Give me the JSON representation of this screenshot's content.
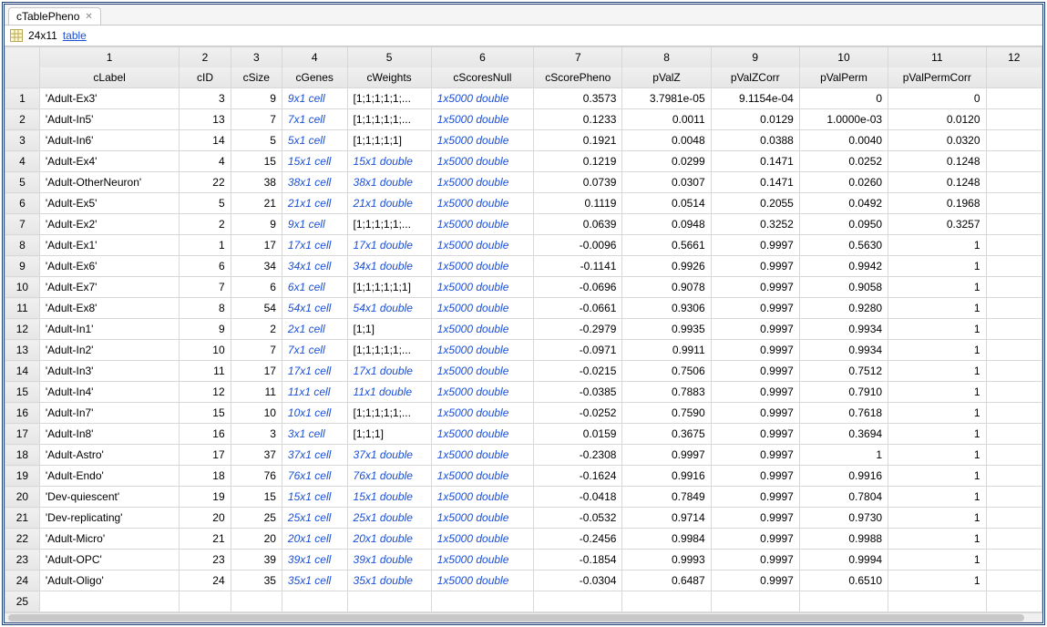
{
  "tab": {
    "title": "cTablePheno"
  },
  "summary": {
    "dims": "24x11",
    "type_link": "table"
  },
  "columns": [
    {
      "num": "1",
      "name": "cLabel",
      "align": "la"
    },
    {
      "num": "2",
      "name": "cID",
      "align": "ra"
    },
    {
      "num": "3",
      "name": "cSize",
      "align": "ra"
    },
    {
      "num": "4",
      "name": "cGenes",
      "align": "la",
      "link": true
    },
    {
      "num": "5",
      "name": "cWeights",
      "align": "la"
    },
    {
      "num": "6",
      "name": "cScoresNull",
      "align": "la",
      "link": true
    },
    {
      "num": "7",
      "name": "cScorePheno",
      "align": "ra"
    },
    {
      "num": "8",
      "name": "pValZ",
      "align": "ra"
    },
    {
      "num": "9",
      "name": "pValZCorr",
      "align": "ra"
    },
    {
      "num": "10",
      "name": "pValPerm",
      "align": "ra"
    },
    {
      "num": "11",
      "name": "pValPermCorr",
      "align": "ra"
    },
    {
      "num": "12",
      "name": "",
      "align": "la"
    }
  ],
  "rows": [
    {
      "n": "1",
      "cLabel": "'Adult-Ex3'",
      "cID": "3",
      "cSize": "9",
      "cGenes": "9x1 cell",
      "cWeights": "[1;1;1;1;1;...",
      "cScoresNull": "1x5000 double",
      "cScorePheno": "0.3573",
      "pValZ": "3.7981e-05",
      "pValZCorr": "9.1154e-04",
      "pValPerm": "0",
      "pValPermCorr": "0"
    },
    {
      "n": "2",
      "cLabel": "'Adult-In5'",
      "cID": "13",
      "cSize": "7",
      "cGenes": "7x1 cell",
      "cWeights": "[1;1;1;1;1;...",
      "cScoresNull": "1x5000 double",
      "cScorePheno": "0.1233",
      "pValZ": "0.0011",
      "pValZCorr": "0.0129",
      "pValPerm": "1.0000e-03",
      "pValPermCorr": "0.0120"
    },
    {
      "n": "3",
      "cLabel": "'Adult-In6'",
      "cID": "14",
      "cSize": "5",
      "cGenes": "5x1 cell",
      "cWeights": "[1;1;1;1;1]",
      "cScoresNull": "1x5000 double",
      "cScorePheno": "0.1921",
      "pValZ": "0.0048",
      "pValZCorr": "0.0388",
      "pValPerm": "0.0040",
      "pValPermCorr": "0.0320"
    },
    {
      "n": "4",
      "cLabel": "'Adult-Ex4'",
      "cID": "4",
      "cSize": "15",
      "cGenes": "15x1 cell",
      "cWeights": "15x1 double",
      "wlink": true,
      "cScoresNull": "1x5000 double",
      "cScorePheno": "0.1219",
      "pValZ": "0.0299",
      "pValZCorr": "0.1471",
      "pValPerm": "0.0252",
      "pValPermCorr": "0.1248"
    },
    {
      "n": "5",
      "cLabel": "'Adult-OtherNeuron'",
      "cID": "22",
      "cSize": "38",
      "cGenes": "38x1 cell",
      "cWeights": "38x1 double",
      "wlink": true,
      "cScoresNull": "1x5000 double",
      "cScorePheno": "0.0739",
      "pValZ": "0.0307",
      "pValZCorr": "0.1471",
      "pValPerm": "0.0260",
      "pValPermCorr": "0.1248"
    },
    {
      "n": "6",
      "cLabel": "'Adult-Ex5'",
      "cID": "5",
      "cSize": "21",
      "cGenes": "21x1 cell",
      "cWeights": "21x1 double",
      "wlink": true,
      "cScoresNull": "1x5000 double",
      "cScorePheno": "0.1119",
      "pValZ": "0.0514",
      "pValZCorr": "0.2055",
      "pValPerm": "0.0492",
      "pValPermCorr": "0.1968"
    },
    {
      "n": "7",
      "cLabel": "'Adult-Ex2'",
      "cID": "2",
      "cSize": "9",
      "cGenes": "9x1 cell",
      "cWeights": "[1;1;1;1;1;...",
      "cScoresNull": "1x5000 double",
      "cScorePheno": "0.0639",
      "pValZ": "0.0948",
      "pValZCorr": "0.3252",
      "pValPerm": "0.0950",
      "pValPermCorr": "0.3257"
    },
    {
      "n": "8",
      "cLabel": "'Adult-Ex1'",
      "cID": "1",
      "cSize": "17",
      "cGenes": "17x1 cell",
      "cWeights": "17x1 double",
      "wlink": true,
      "cScoresNull": "1x5000 double",
      "cScorePheno": "-0.0096",
      "pValZ": "0.5661",
      "pValZCorr": "0.9997",
      "pValPerm": "0.5630",
      "pValPermCorr": "1"
    },
    {
      "n": "9",
      "cLabel": "'Adult-Ex6'",
      "cID": "6",
      "cSize": "34",
      "cGenes": "34x1 cell",
      "cWeights": "34x1 double",
      "wlink": true,
      "cScoresNull": "1x5000 double",
      "cScorePheno": "-0.1141",
      "pValZ": "0.9926",
      "pValZCorr": "0.9997",
      "pValPerm": "0.9942",
      "pValPermCorr": "1"
    },
    {
      "n": "10",
      "cLabel": "'Adult-Ex7'",
      "cID": "7",
      "cSize": "6",
      "cGenes": "6x1 cell",
      "cWeights": "[1;1;1;1;1;1]",
      "cScoresNull": "1x5000 double",
      "cScorePheno": "-0.0696",
      "pValZ": "0.9078",
      "pValZCorr": "0.9997",
      "pValPerm": "0.9058",
      "pValPermCorr": "1"
    },
    {
      "n": "11",
      "cLabel": "'Adult-Ex8'",
      "cID": "8",
      "cSize": "54",
      "cGenes": "54x1 cell",
      "cWeights": "54x1 double",
      "wlink": true,
      "cScoresNull": "1x5000 double",
      "cScorePheno": "-0.0661",
      "pValZ": "0.9306",
      "pValZCorr": "0.9997",
      "pValPerm": "0.9280",
      "pValPermCorr": "1"
    },
    {
      "n": "12",
      "cLabel": "'Adult-In1'",
      "cID": "9",
      "cSize": "2",
      "cGenes": "2x1 cell",
      "cWeights": "[1;1]",
      "cScoresNull": "1x5000 double",
      "cScorePheno": "-0.2979",
      "pValZ": "0.9935",
      "pValZCorr": "0.9997",
      "pValPerm": "0.9934",
      "pValPermCorr": "1"
    },
    {
      "n": "13",
      "cLabel": "'Adult-In2'",
      "cID": "10",
      "cSize": "7",
      "cGenes": "7x1 cell",
      "cWeights": "[1;1;1;1;1;...",
      "cScoresNull": "1x5000 double",
      "cScorePheno": "-0.0971",
      "pValZ": "0.9911",
      "pValZCorr": "0.9997",
      "pValPerm": "0.9934",
      "pValPermCorr": "1"
    },
    {
      "n": "14",
      "cLabel": "'Adult-In3'",
      "cID": "11",
      "cSize": "17",
      "cGenes": "17x1 cell",
      "cWeights": "17x1 double",
      "wlink": true,
      "cScoresNull": "1x5000 double",
      "cScorePheno": "-0.0215",
      "pValZ": "0.7506",
      "pValZCorr": "0.9997",
      "pValPerm": "0.7512",
      "pValPermCorr": "1"
    },
    {
      "n": "15",
      "cLabel": "'Adult-In4'",
      "cID": "12",
      "cSize": "11",
      "cGenes": "11x1 cell",
      "cWeights": "11x1 double",
      "wlink": true,
      "cScoresNull": "1x5000 double",
      "cScorePheno": "-0.0385",
      "pValZ": "0.7883",
      "pValZCorr": "0.9997",
      "pValPerm": "0.7910",
      "pValPermCorr": "1"
    },
    {
      "n": "16",
      "cLabel": "'Adult-In7'",
      "cID": "15",
      "cSize": "10",
      "cGenes": "10x1 cell",
      "cWeights": "[1;1;1;1;1;...",
      "cScoresNull": "1x5000 double",
      "cScorePheno": "-0.0252",
      "pValZ": "0.7590",
      "pValZCorr": "0.9997",
      "pValPerm": "0.7618",
      "pValPermCorr": "1"
    },
    {
      "n": "17",
      "cLabel": "'Adult-In8'",
      "cID": "16",
      "cSize": "3",
      "cGenes": "3x1 cell",
      "cWeights": "[1;1;1]",
      "cScoresNull": "1x5000 double",
      "cScorePheno": "0.0159",
      "pValZ": "0.3675",
      "pValZCorr": "0.9997",
      "pValPerm": "0.3694",
      "pValPermCorr": "1"
    },
    {
      "n": "18",
      "cLabel": "'Adult-Astro'",
      "cID": "17",
      "cSize": "37",
      "cGenes": "37x1 cell",
      "cWeights": "37x1 double",
      "wlink": true,
      "cScoresNull": "1x5000 double",
      "cScorePheno": "-0.2308",
      "pValZ": "0.9997",
      "pValZCorr": "0.9997",
      "pValPerm": "1",
      "pValPermCorr": "1"
    },
    {
      "n": "19",
      "cLabel": "'Adult-Endo'",
      "cID": "18",
      "cSize": "76",
      "cGenes": "76x1 cell",
      "cWeights": "76x1 double",
      "wlink": true,
      "cScoresNull": "1x5000 double",
      "cScorePheno": "-0.1624",
      "pValZ": "0.9916",
      "pValZCorr": "0.9997",
      "pValPerm": "0.9916",
      "pValPermCorr": "1"
    },
    {
      "n": "20",
      "cLabel": "'Dev-quiescent'",
      "cID": "19",
      "cSize": "15",
      "cGenes": "15x1 cell",
      "cWeights": "15x1 double",
      "wlink": true,
      "cScoresNull": "1x5000 double",
      "cScorePheno": "-0.0418",
      "pValZ": "0.7849",
      "pValZCorr": "0.9997",
      "pValPerm": "0.7804",
      "pValPermCorr": "1"
    },
    {
      "n": "21",
      "cLabel": "'Dev-replicating'",
      "cID": "20",
      "cSize": "25",
      "cGenes": "25x1 cell",
      "cWeights": "25x1 double",
      "wlink": true,
      "cScoresNull": "1x5000 double",
      "cScorePheno": "-0.0532",
      "pValZ": "0.9714",
      "pValZCorr": "0.9997",
      "pValPerm": "0.9730",
      "pValPermCorr": "1"
    },
    {
      "n": "22",
      "cLabel": "'Adult-Micro'",
      "cID": "21",
      "cSize": "20",
      "cGenes": "20x1 cell",
      "cWeights": "20x1 double",
      "wlink": true,
      "cScoresNull": "1x5000 double",
      "cScorePheno": "-0.2456",
      "pValZ": "0.9984",
      "pValZCorr": "0.9997",
      "pValPerm": "0.9988",
      "pValPermCorr": "1"
    },
    {
      "n": "23",
      "cLabel": "'Adult-OPC'",
      "cID": "23",
      "cSize": "39",
      "cGenes": "39x1 cell",
      "cWeights": "39x1 double",
      "wlink": true,
      "cScoresNull": "1x5000 double",
      "cScorePheno": "-0.1854",
      "pValZ": "0.9993",
      "pValZCorr": "0.9997",
      "pValPerm": "0.9994",
      "pValPermCorr": "1"
    },
    {
      "n": "24",
      "cLabel": "'Adult-Oligo'",
      "cID": "24",
      "cSize": "35",
      "cGenes": "35x1 cell",
      "cWeights": "35x1 double",
      "wlink": true,
      "cScoresNull": "1x5000 double",
      "cScorePheno": "-0.0304",
      "pValZ": "0.6487",
      "pValZCorr": "0.9997",
      "pValPerm": "0.6510",
      "pValPermCorr": "1"
    },
    {
      "n": "25"
    }
  ]
}
